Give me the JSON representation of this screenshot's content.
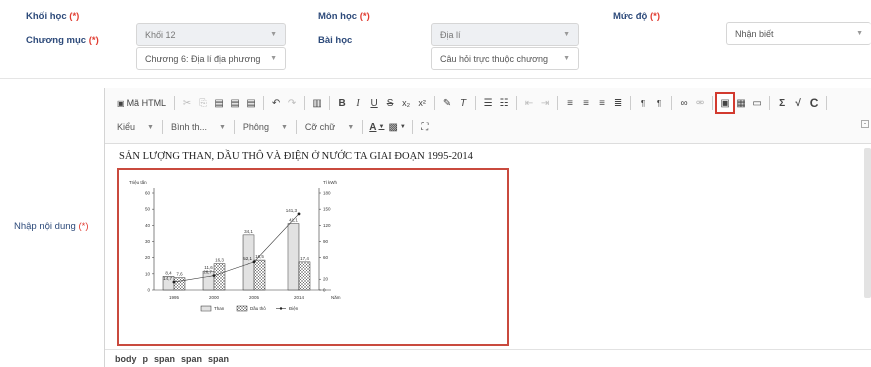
{
  "form": {
    "grade_label": "Khối học",
    "grade_value": "Khối 12",
    "subject_label": "Môn học",
    "subject_value": "Địa lí",
    "level_label": "Mức độ",
    "level_value": "Nhận biết",
    "chapter_label": "Chương mục",
    "chapter_value": "Chương 6: Địa lí địa phương",
    "lesson_label": "Bài học",
    "lesson_value": "Câu hỏi trực thuộc chương",
    "content_label": "Nhập nội dung",
    "required_mark": "(*)"
  },
  "toolbar": {
    "source_label": "Mã HTML",
    "bold": "B",
    "italic": "I",
    "underline": "U",
    "strike": "S",
    "sum": "Σ",
    "sqrt": "√",
    "c_label": "C",
    "style_combo": "Kiểu",
    "format_combo": "Bình th...",
    "font_combo": "Phông",
    "size_combo": "Cỡ chữ",
    "text_color": "A",
    "maximize": "⛶",
    "image_button_highlight": "#d23a2f"
  },
  "document": {
    "title": "SẢN LƯỢNG THAN, DẦU THÔ VÀ ĐIỆN Ở NƯỚC TA GIAI ĐOẠN 1995-2014"
  },
  "chart_data": {
    "type": "bar",
    "categories": [
      "1995",
      "2000",
      "2005",
      "2014"
    ],
    "xlabel_suffix": "Năm",
    "left_axis_label": "Triệu tấn",
    "right_axis_label": "Tỉ kWh",
    "left_ylim": [
      0,
      60
    ],
    "left_ticks": [
      "0",
      "10",
      "20",
      "30",
      "40",
      "50",
      "60"
    ],
    "right_ylim": [
      0,
      180
    ],
    "right_ticks": [
      "0",
      "20",
      "60",
      "90",
      "120",
      "150",
      "180"
    ],
    "series": [
      {
        "name": "Than",
        "axis": "left",
        "values": [
          8.4,
          11.6,
          34.1,
          41.1
        ],
        "labels": [
          "8,4",
          "11,6",
          "34,1",
          "41,1"
        ]
      },
      {
        "name": "Dầu thô",
        "axis": "left",
        "values": [
          7.6,
          16.3,
          18.5,
          17.4
        ],
        "labels": [
          "7,6",
          "16,3",
          "18,5",
          "17,4"
        ]
      },
      {
        "name": "Điện",
        "axis": "right",
        "values": [
          14.7,
          26.7,
          52.1,
          141.3
        ],
        "labels": [
          "14,7",
          "26,7",
          "52,1",
          "141,3"
        ]
      }
    ]
  },
  "statusbar": {
    "path": [
      "body",
      "p",
      "span",
      "span",
      "span"
    ]
  }
}
